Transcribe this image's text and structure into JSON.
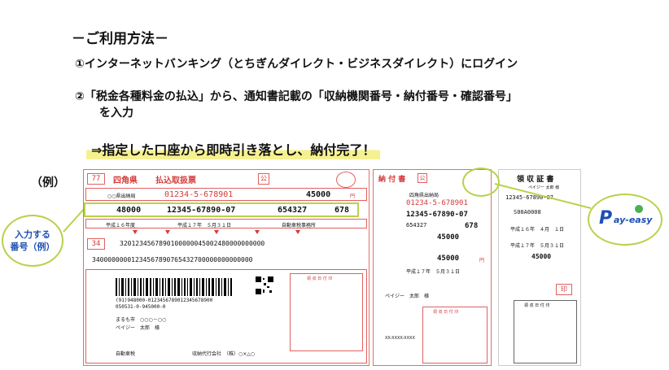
{
  "title": "－ご利用方法－",
  "steps": {
    "s1": "①インターネットバンキング（とちぎんダイレクト・ビジネスダイレクト）にログイン",
    "s2a": "②「税金各種料金の払込」から、通知書記載の「収納機関番号・納付番号・確認番号」",
    "s2b": "を入力"
  },
  "result": "⇒指定した口座から即時引き落とし、納付完了！",
  "example_label": "（例）",
  "callout": {
    "line1": "入力する",
    "line2": "番号（例）"
  },
  "slip": {
    "code": "77",
    "pref": "四角県",
    "form_name": "払込取扱票",
    "ko": "公",
    "payee": "○○県出納局",
    "account": "01234-5-678901",
    "amount": "45000",
    "yen": "円",
    "shuno": "48000",
    "nofu": "12345-67890-07",
    "kakunin": "654327",
    "other_num": "678",
    "year_label": "平成１６年度",
    "deadline": "平成１７年　５月３１日",
    "tax_office": "自動車税事務所",
    "ocr_code": "34",
    "ocr1": "3201234567890100000045002480000000000",
    "ocr2": "34000000001234567890765432700000000000000",
    "barcode_text1": "(91)948000-0123456789012345678900",
    "barcode_text2": "050531-0-945000-0",
    "addr": "まるも市　○○○－○○",
    "name": "ペイジー　太郎　様",
    "car": "自動車税",
    "agent": "収納代行会社　（株）○×△○",
    "stamp": "領 収 日 付 印"
  },
  "slip2": {
    "title": "納 付 書",
    "ko": "公",
    "payee": "四角県出納局",
    "account": "01234-5-678901",
    "nofu": "12345-67890-07",
    "kakunin": "654327",
    "other_num": "678",
    "amount": "45000",
    "total": "45000",
    "yen": "円",
    "deadline": "平成１７年　５月３１日",
    "name": "ペイジー　太郎　様",
    "tel": "XX-XXXX-XXXX",
    "stamp": "領 収 日 付 印"
  },
  "slip3": {
    "title": "領 収 証 書",
    "name": "ペイジー 太郎 様",
    "account": "12345-67890-07",
    "receipt_no": "S00A0008",
    "date1": "平成１６年　４月　１日",
    "date2": "平成１７年　５月３１日",
    "amount": "45000",
    "stamp": "印",
    "stamp2": "領 収 日 付 印"
  },
  "logo": {
    "text": "ay-easy",
    "p": "P"
  },
  "colors": {
    "accent_green": "#b7d24a",
    "slip_red": "#d43a3a",
    "highlight": "#f6f190"
  }
}
